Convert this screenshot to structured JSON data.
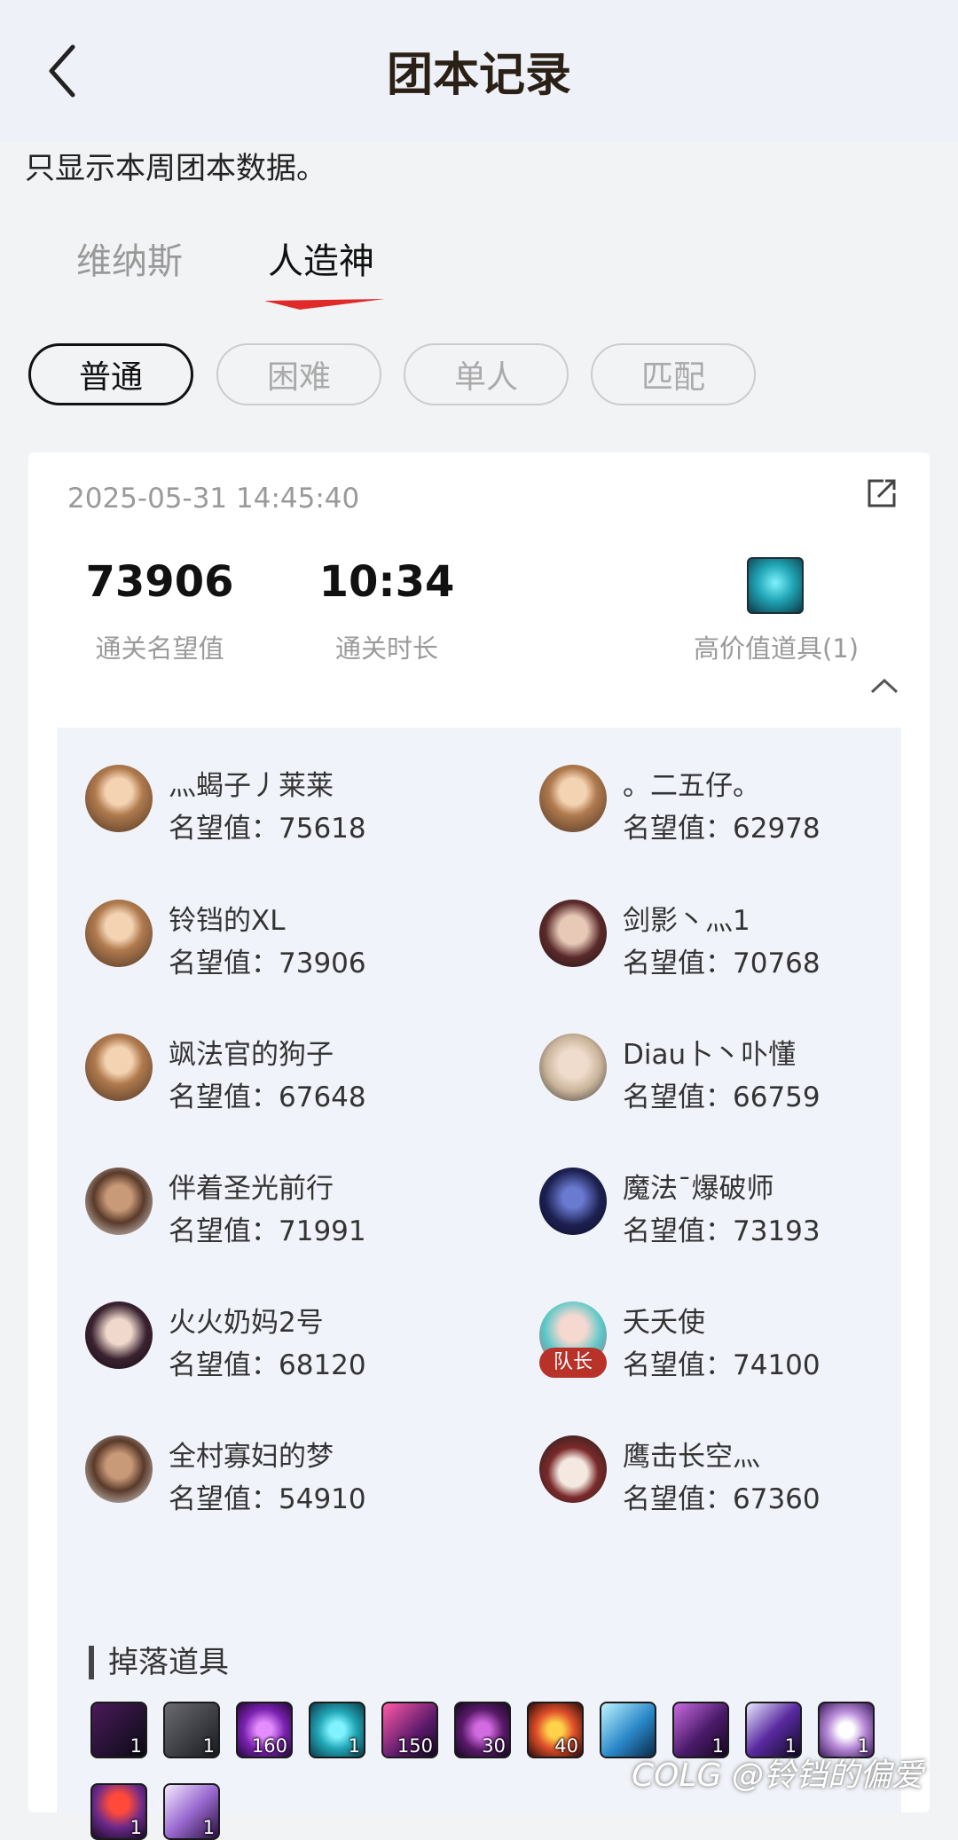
{
  "header": {
    "title": "团本记录"
  },
  "notice": "只显示本周团本数据。",
  "tabs": [
    {
      "label": "维纳斯"
    },
    {
      "label": "人造神"
    }
  ],
  "filters": [
    {
      "label": "普通"
    },
    {
      "label": "困难"
    },
    {
      "label": "单人"
    },
    {
      "label": "匹配"
    }
  ],
  "record": {
    "datetime": "2025-05-31 14:45:40",
    "stats": [
      {
        "value": "73906",
        "label": "通关名望值"
      },
      {
        "value": "10:34",
        "label": "通关时长"
      }
    ],
    "high_value_label": "高价值道具(1)",
    "members": [
      {
        "name": "灬蝎子丿莱莱",
        "rep": "名望值：75618"
      },
      {
        "name": "。二五仔。",
        "rep": "名望值：62978"
      },
      {
        "name": "铃铛的XL",
        "rep": "名望值：73906"
      },
      {
        "name": "剑影丶灬1",
        "rep": "名望值：70768"
      },
      {
        "name": "飒法官的狗子",
        "rep": "名望值：67648"
      },
      {
        "name": "Diau卜丶卟懂",
        "rep": "名望值：66759"
      },
      {
        "name": "伴着圣光前行",
        "rep": "名望值：71991"
      },
      {
        "name": "魔法ˉ爆破师",
        "rep": "名望值：73193"
      },
      {
        "name": "火火奶妈2号",
        "rep": "名望值：68120"
      },
      {
        "name": "夭夭使",
        "rep": "名望值：74100",
        "badge": "队长"
      },
      {
        "name": "全村寡妇的梦",
        "rep": "名望值：54910"
      },
      {
        "name": "鹰击长空灬",
        "rep": "名望值：67360"
      }
    ],
    "drops_title": "掉落道具",
    "drops": [
      {
        "qty": "1"
      },
      {
        "qty": "1"
      },
      {
        "qty": "160"
      },
      {
        "qty": "1"
      },
      {
        "qty": "150"
      },
      {
        "qty": "30"
      },
      {
        "qty": "40"
      },
      {
        "qty": ""
      },
      {
        "qty": "1"
      },
      {
        "qty": "1"
      },
      {
        "qty": "1"
      },
      {
        "qty": "1"
      },
      {
        "qty": "1"
      }
    ]
  },
  "watermark": "COLG @铃铛的偏爱",
  "colors": {
    "accent_red": "#e02a2a",
    "panel_bg": "#f0f3f9",
    "leader_badge": "#b8322a"
  }
}
